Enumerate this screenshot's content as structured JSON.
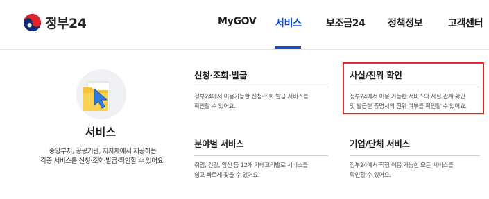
{
  "brand": {
    "logo_text": "정부24",
    "accent_color": "#0b50d0"
  },
  "nav": {
    "items": [
      {
        "label": "MyGOV",
        "active": false
      },
      {
        "label": "서비스",
        "active": true
      },
      {
        "label": "보조금24",
        "active": false
      },
      {
        "label": "정책정보",
        "active": false
      },
      {
        "label": "고객센터",
        "active": false
      }
    ]
  },
  "hero": {
    "icon": "folder-cursor-icon",
    "title": "서비스",
    "desc_line1": "중앙부처, 공공기관, 지자체에서 제공하는",
    "desc_line2": "각종 서비스를 신청·조회·발급·확인할 수 있어요."
  },
  "cards": [
    {
      "title": "신청·조회·발급",
      "desc_line1": "정부24에서 이용가능한 신청·조회·발급 서비스를",
      "desc_line2": "확인할 수 있어요."
    },
    {
      "title": "사실/진위 확인",
      "desc_line1": "정부24에서 이용 가능한 서비스의 사실 관계 확인",
      "desc_line2": "및 발급한 증명서의 진위 여부를 확인할 수 있어요.",
      "highlighted": true
    },
    {
      "title": "분야별 서비스",
      "desc_line1": "취업, 건강, 임신 등 12개 카테고리별로 서비스를",
      "desc_line2": "쉽고 빠르게 찾을 수 있어요."
    },
    {
      "title": "기업/단체 서비스",
      "desc_line1": "정부24에서 직접 이용 가능한 모든 서비스를",
      "desc_line2": "확인할 수 있어요."
    }
  ],
  "highlight_color": "#e32a2a"
}
